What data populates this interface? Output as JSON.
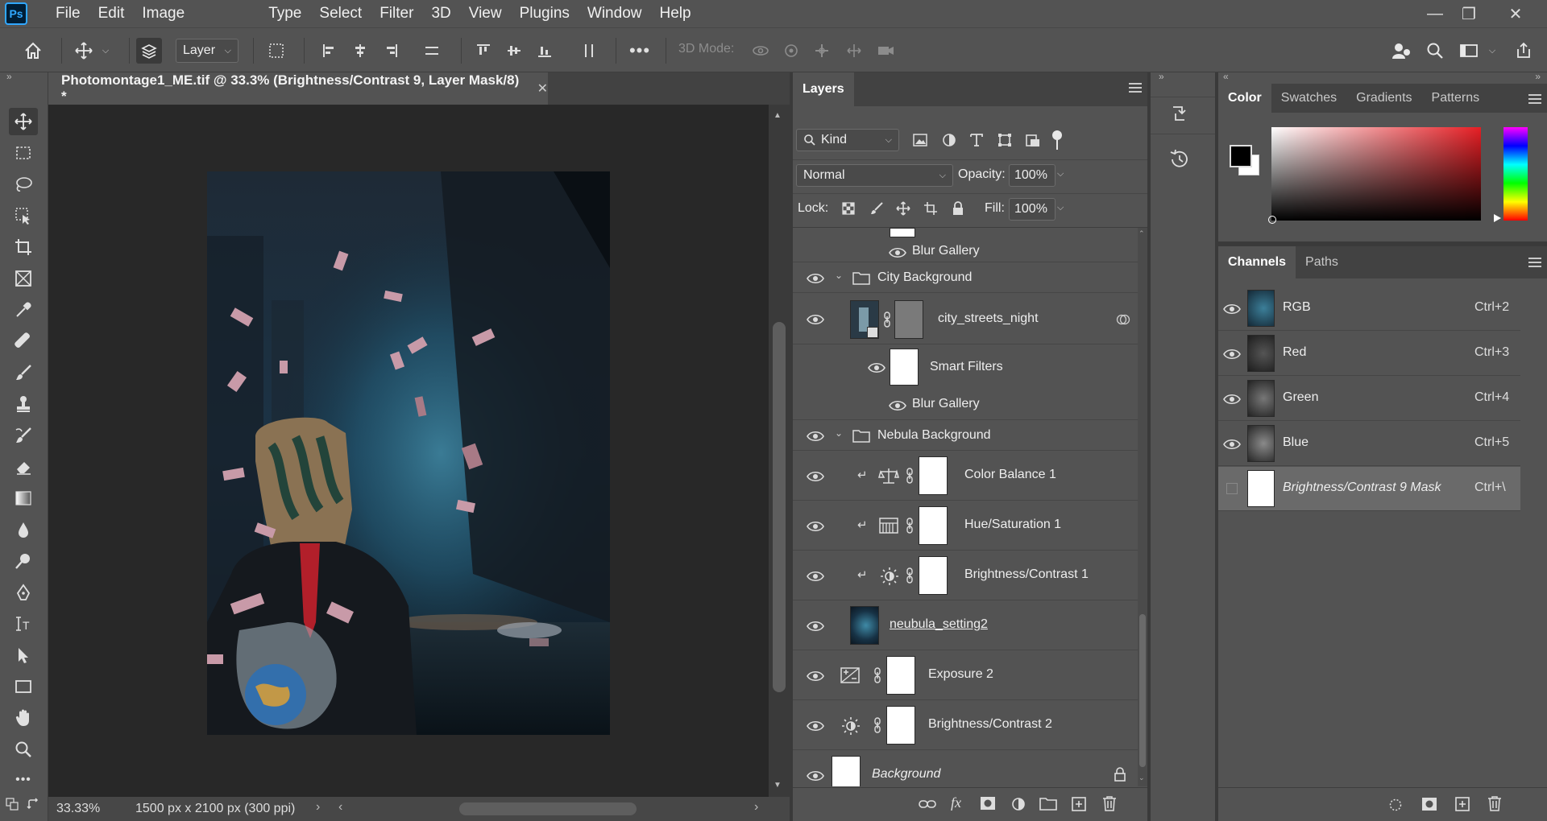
{
  "app": {
    "logo": "Ps"
  },
  "menu": [
    "File",
    "Edit",
    "Image",
    "Type",
    "Select",
    "Filter",
    "3D",
    "View",
    "Plugins",
    "Window",
    "Help"
  ],
  "options": {
    "layer_select": "Layer",
    "mode_label": "3D Mode:"
  },
  "document": {
    "tab_title": "Photomontage1_ME.tif @ 33.3% (Brightness/Contrast 9, Layer Mask/8) *",
    "zoom": "33.33%",
    "dimensions": "1500 px x 2100 px (300 ppi)"
  },
  "layers_panel": {
    "title": "Layers",
    "filter_kind": "Kind",
    "blend_mode": "Normal",
    "opacity_label": "Opacity:",
    "opacity_value": "100%",
    "lock_label": "Lock:",
    "fill_label": "Fill:",
    "fill_value": "100%",
    "rows": [
      {
        "name": "Blur Gallery"
      },
      {
        "name": "City Background"
      },
      {
        "name": "city_streets_night"
      },
      {
        "name": "Smart Filters"
      },
      {
        "name": "Blur Gallery"
      },
      {
        "name": "Nebula Background"
      },
      {
        "name": "Color Balance 1"
      },
      {
        "name": "Hue/Saturation 1"
      },
      {
        "name": "Brightness/Contrast 1"
      },
      {
        "name": "neubula_setting2"
      },
      {
        "name": "Exposure 2"
      },
      {
        "name": "Brightness/Contrast 2"
      },
      {
        "name": "Background"
      }
    ]
  },
  "color_panel": {
    "tabs": [
      "Color",
      "Swatches",
      "Gradients",
      "Patterns"
    ]
  },
  "channels_panel": {
    "tabs": [
      "Channels",
      "Paths"
    ],
    "channels": [
      {
        "name": "RGB",
        "shortcut": "Ctrl+2"
      },
      {
        "name": "Red",
        "shortcut": "Ctrl+3"
      },
      {
        "name": "Green",
        "shortcut": "Ctrl+4"
      },
      {
        "name": "Blue",
        "shortcut": "Ctrl+5"
      },
      {
        "name": "Brightness/Contrast 9 Mask",
        "shortcut": "Ctrl+\\"
      }
    ]
  }
}
